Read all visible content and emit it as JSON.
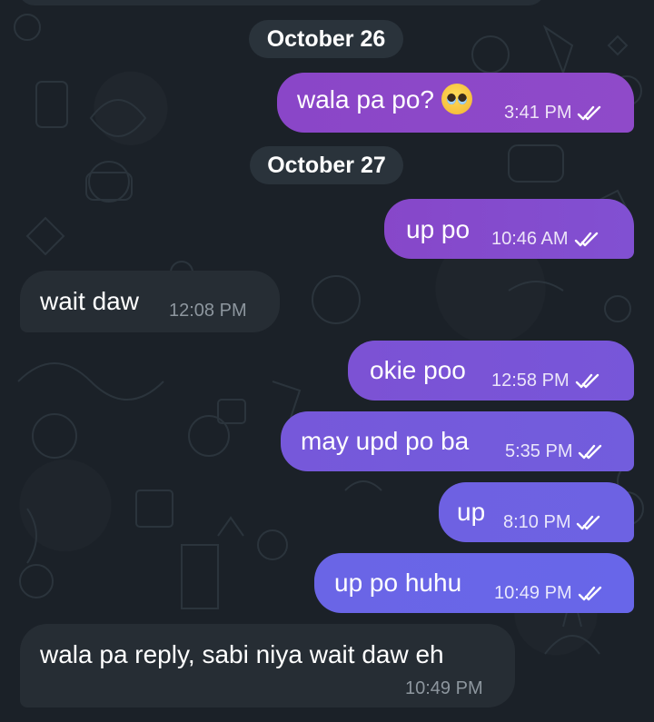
{
  "colors": {
    "background": "#1b2128",
    "incoming_bubble": "#262d34",
    "date_chip": "#2a333b",
    "outgoing_gradient": [
      "#8a46c8",
      "#6a63e8"
    ]
  },
  "dates": [
    {
      "label": "October 26"
    },
    {
      "label": "October 27"
    }
  ],
  "messages": [
    {
      "text": "wala pa po?",
      "time": "3:41 PM",
      "direction": "out",
      "emoji": "pleading-face",
      "read": true
    },
    {
      "text": "up po",
      "time": "10:46 AM",
      "direction": "out",
      "read": true
    },
    {
      "text": "wait daw",
      "time": "12:08 PM",
      "direction": "in"
    },
    {
      "text": "okie poo",
      "time": "12:58 PM",
      "direction": "out",
      "read": true
    },
    {
      "text": "may upd po ba",
      "time": "5:35 PM",
      "direction": "out",
      "read": true
    },
    {
      "text": "up",
      "time": "8:10 PM",
      "direction": "out",
      "read": true
    },
    {
      "text": "up po huhu",
      "time": "10:49 PM",
      "direction": "out",
      "read": true
    },
    {
      "text": "wala pa reply, sabi niya wait daw eh",
      "time": "10:49 PM",
      "direction": "in"
    }
  ]
}
